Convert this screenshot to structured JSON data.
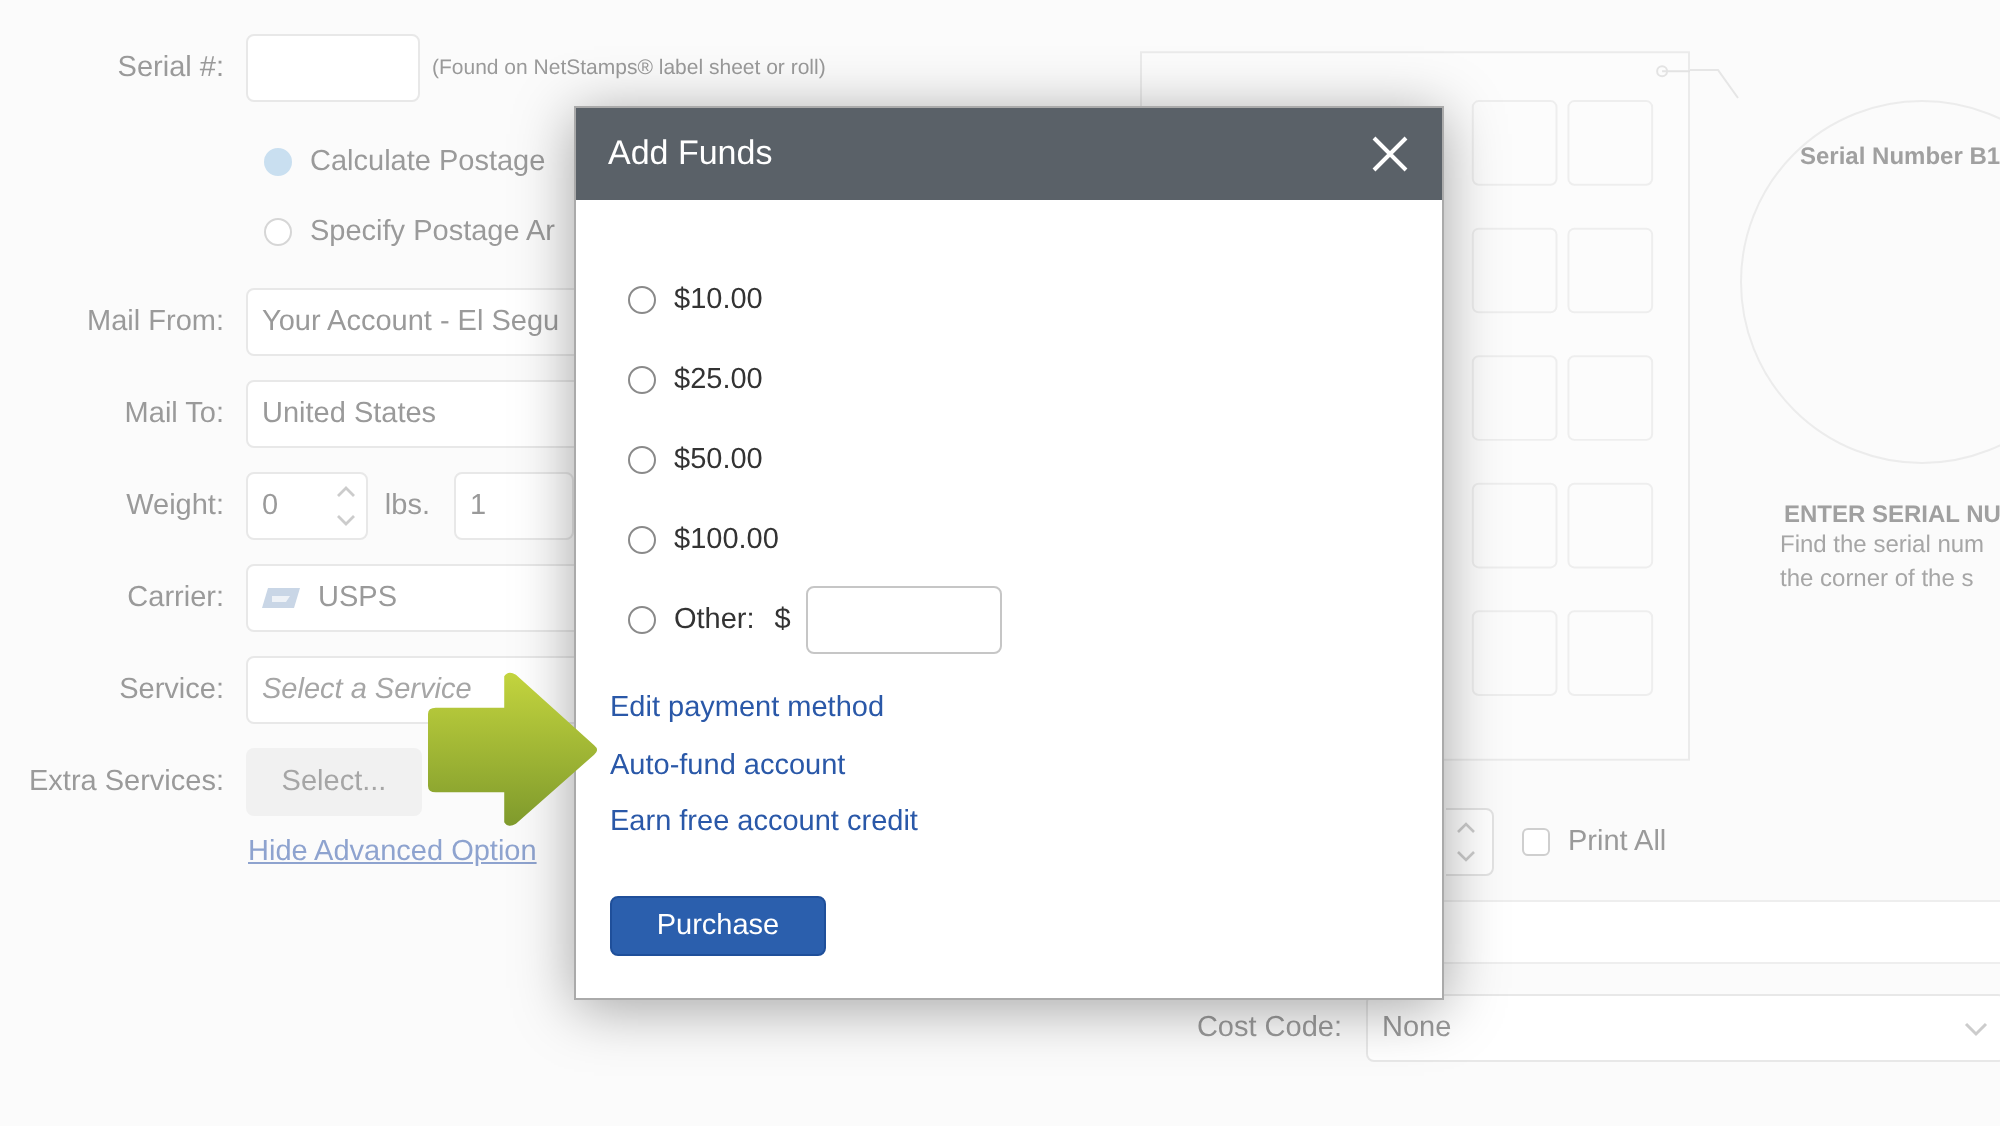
{
  "background_form": {
    "serial": {
      "label": "Serial #:",
      "hint": "(Found on NetStamps® label sheet or roll)"
    },
    "postage_options": [
      {
        "label": "Calculate Postage",
        "selected": true
      },
      {
        "label": "Specify Postage Ar",
        "selected": false
      }
    ],
    "fields": [
      {
        "label": "Mail From:",
        "value": "Your Account - El Segu"
      },
      {
        "label": "Mail To:",
        "value": "United States"
      }
    ],
    "weight": {
      "label": "Weight:",
      "pounds": "0",
      "unit": "lbs.",
      "ounces": "1"
    },
    "carrier": {
      "label": "Carrier:",
      "value": "USPS"
    },
    "service": {
      "label": "Service:",
      "placeholder": "Select a Service"
    },
    "extra_services": {
      "label": "Extra Services:",
      "button": "Select..."
    },
    "advanced_link": "Hide Advanced Option"
  },
  "sheet_preview": {
    "circle_label": "Serial Number B1",
    "heading": "ENTER SERIAL NU",
    "text_lines": [
      "Find the serial num",
      "the corner of the s"
    ]
  },
  "print_all": {
    "label": "Print All",
    "checked": false
  },
  "cost_code": {
    "label": "Cost Code:",
    "value": "None"
  },
  "dialog": {
    "title": "Add Funds",
    "amounts": [
      {
        "label": "$10.00",
        "selected": false
      },
      {
        "label": "$25.00",
        "selected": false
      },
      {
        "label": "$50.00",
        "selected": false
      },
      {
        "label": "$100.00",
        "selected": false
      }
    ],
    "other": {
      "label": "Other:",
      "currency": "$",
      "selected": false
    },
    "links": [
      "Edit payment method",
      "Auto-fund account",
      "Earn free account credit"
    ],
    "button": "Purchase"
  }
}
